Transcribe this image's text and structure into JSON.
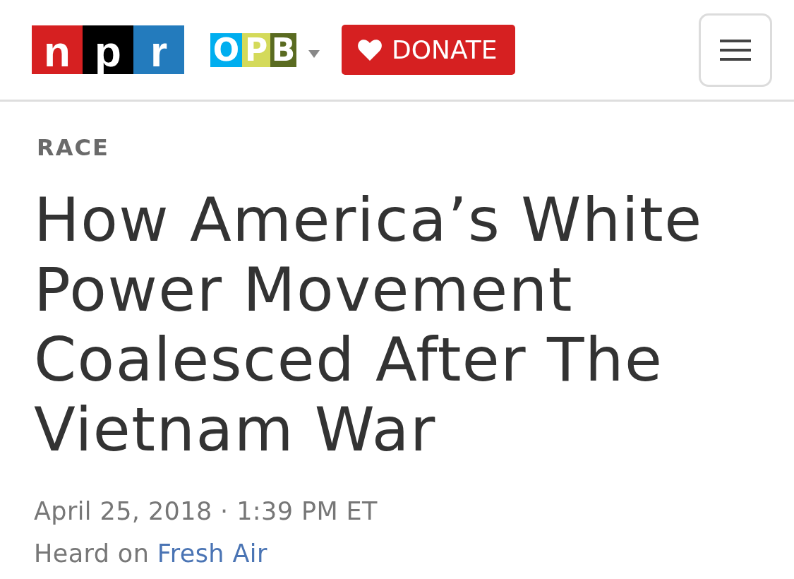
{
  "header": {
    "npr_logo": [
      "n",
      "p",
      "r"
    ],
    "station_logo": {
      "letters": [
        "O",
        "P",
        "B"
      ]
    },
    "donate_button": "DONATE"
  },
  "article": {
    "section": "RACE",
    "title": "How America’s White Power Movement Coalesced After The Vietnam War",
    "date": "April 25, 2018 · 1:39 PM ET",
    "heard_on": {
      "label": "Heard on",
      "program": "Fresh Air"
    }
  }
}
